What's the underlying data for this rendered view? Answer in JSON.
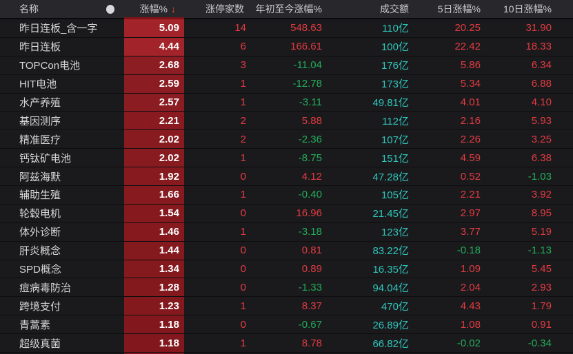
{
  "header": {
    "columns": [
      "名称",
      "涨幅%",
      "涨停家数",
      "年初至今涨幅%",
      "成交额",
      "5日涨幅%",
      "10日涨幅%"
    ],
    "sort_arrow": "↓",
    "sort_column": "涨幅%",
    "circle_icon": "circle-indicator"
  },
  "colors": {
    "up": "#e23b41",
    "down": "#23ad5a",
    "turnover": "#2fc5ba",
    "cell_text": "#ffffff",
    "name_text": "#d6d6d8",
    "header_bg": "#28282c",
    "row_bg": "#1a1a1d",
    "sort_arrow": "#e8432e"
  },
  "rows": [
    {
      "name": "昨日连板_含一字",
      "chg": "5.09",
      "count": "14",
      "ytd": "548.63",
      "turnover": "110亿",
      "d5": "20.25",
      "d10": "31.90",
      "cell_bg": "#a2232a"
    },
    {
      "name": "昨日连板",
      "chg": "4.44",
      "count": "6",
      "ytd": "166.61",
      "turnover": "100亿",
      "d5": "22.42",
      "d10": "18.33",
      "cell_bg": "#a2232a"
    },
    {
      "name": "TOPCon电池",
      "chg": "2.68",
      "count": "3",
      "ytd": "-11.04",
      "turnover": "176亿",
      "d5": "5.86",
      "d10": "6.34",
      "cell_bg": "#8c1d22"
    },
    {
      "name": "HIT电池",
      "chg": "2.59",
      "count": "1",
      "ytd": "-12.78",
      "turnover": "173亿",
      "d5": "5.34",
      "d10": "6.88",
      "cell_bg": "#8b1c21"
    },
    {
      "name": "水产养殖",
      "chg": "2.57",
      "count": "1",
      "ytd": "-3.11",
      "turnover": "49.81亿",
      "d5": "4.01",
      "d10": "4.10",
      "cell_bg": "#8b1c21"
    },
    {
      "name": "基因测序",
      "chg": "2.21",
      "count": "2",
      "ytd": "5.88",
      "turnover": "112亿",
      "d5": "2.16",
      "d10": "5.93",
      "cell_bg": "#891b20"
    },
    {
      "name": "精准医疗",
      "chg": "2.02",
      "count": "2",
      "ytd": "-2.36",
      "turnover": "107亿",
      "d5": "2.26",
      "d10": "3.25",
      "cell_bg": "#881b20"
    },
    {
      "name": "钙钛矿电池",
      "chg": "2.02",
      "count": "1",
      "ytd": "-8.75",
      "turnover": "151亿",
      "d5": "4.59",
      "d10": "6.38",
      "cell_bg": "#881b20"
    },
    {
      "name": "阿兹海默",
      "chg": "1.92",
      "count": "0",
      "ytd": "4.12",
      "turnover": "47.28亿",
      "d5": "0.52",
      "d10": "-1.03",
      "cell_bg": "#871a1f"
    },
    {
      "name": "辅助生殖",
      "chg": "1.66",
      "count": "1",
      "ytd": "-0.40",
      "turnover": "105亿",
      "d5": "2.21",
      "d10": "3.92",
      "cell_bg": "#861a1f"
    },
    {
      "name": "轮毂电机",
      "chg": "1.54",
      "count": "0",
      "ytd": "16.96",
      "turnover": "21.45亿",
      "d5": "2.97",
      "d10": "8.95",
      "cell_bg": "#85191e"
    },
    {
      "name": "体外诊断",
      "chg": "1.46",
      "count": "1",
      "ytd": "-3.18",
      "turnover": "123亿",
      "d5": "3.77",
      "d10": "5.19",
      "cell_bg": "#85191e"
    },
    {
      "name": "肝炎概念",
      "chg": "1.44",
      "count": "0",
      "ytd": "0.81",
      "turnover": "83.22亿",
      "d5": "-0.18",
      "d10": "-1.13",
      "cell_bg": "#84191e"
    },
    {
      "name": "SPD概念",
      "chg": "1.34",
      "count": "0",
      "ytd": "0.89",
      "turnover": "16.35亿",
      "d5": "1.09",
      "d10": "5.45",
      "cell_bg": "#84191e"
    },
    {
      "name": "痘病毒防治",
      "chg": "1.28",
      "count": "0",
      "ytd": "-1.33",
      "turnover": "94.04亿",
      "d5": "2.04",
      "d10": "2.93",
      "cell_bg": "#83181d"
    },
    {
      "name": "跨境支付",
      "chg": "1.23",
      "count": "1",
      "ytd": "8.37",
      "turnover": "470亿",
      "d5": "4.43",
      "d10": "1.79",
      "cell_bg": "#83181d"
    },
    {
      "name": "青蒿素",
      "chg": "1.18",
      "count": "0",
      "ytd": "-0.67",
      "turnover": "26.89亿",
      "d5": "1.08",
      "d10": "0.91",
      "cell_bg": "#82181d"
    },
    {
      "name": "超级真菌",
      "chg": "1.18",
      "count": "1",
      "ytd": "8.78",
      "turnover": "66.82亿",
      "d5": "-0.02",
      "d10": "-0.34",
      "cell_bg": "#82181d"
    }
  ]
}
